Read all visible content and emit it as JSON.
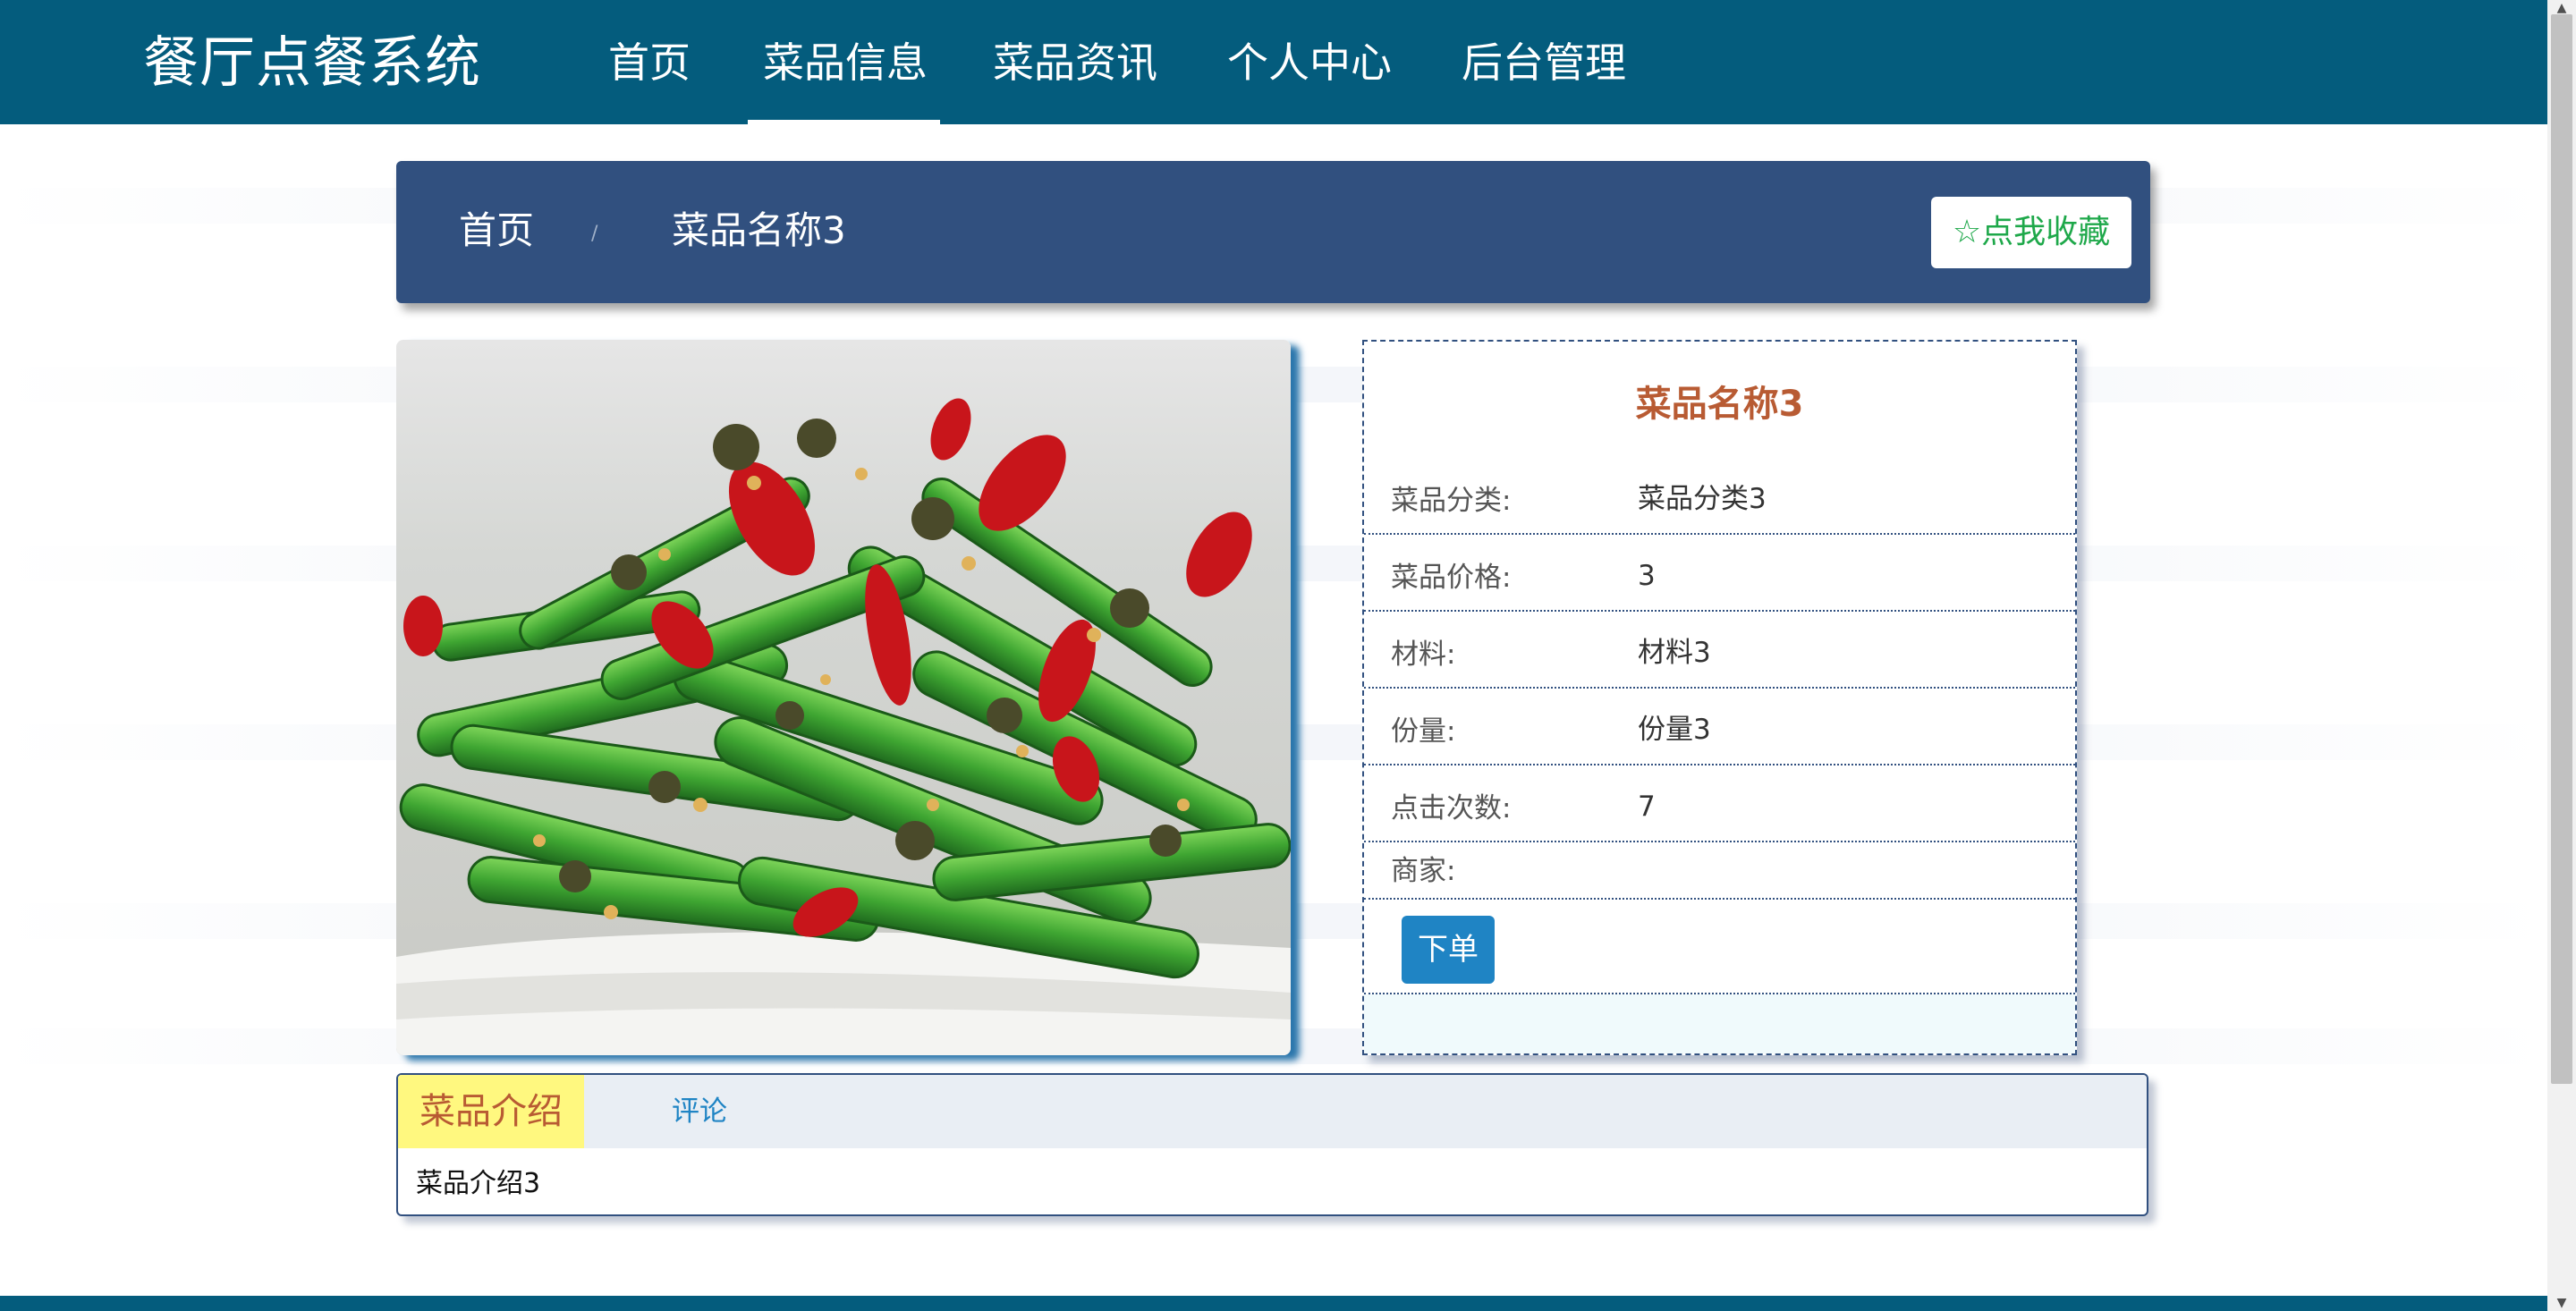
{
  "header": {
    "brand": "餐厅点餐系统",
    "nav": [
      "首页",
      "菜品信息",
      "菜品资讯",
      "个人中心",
      "后台管理"
    ],
    "active_index": 1
  },
  "breadcrumb": {
    "home": "首页",
    "separator": "/",
    "current": "菜品名称3"
  },
  "favorite_button": {
    "icon": "star-outline-icon",
    "label": "点我收藏"
  },
  "dish": {
    "image_alt": "dish-photo",
    "title": "菜品名称3",
    "fields": [
      {
        "label": "菜品分类:",
        "value": "菜品分类3"
      },
      {
        "label": "菜品价格:",
        "value": "3"
      },
      {
        "label": "材料:",
        "value": "材料3"
      },
      {
        "label": "份量:",
        "value": "份量3"
      },
      {
        "label": "点击次数:",
        "value": "7"
      },
      {
        "label": "商家:",
        "value": ""
      }
    ],
    "order_label": "下单"
  },
  "tabs": {
    "items": [
      "菜品介绍",
      "评论"
    ],
    "active_index": 0,
    "content": "菜品介绍3"
  },
  "colors": {
    "header_bg": "#045C7D",
    "breadcrumb_bg": "#31507F",
    "title_color": "#B85B33",
    "favorite_text": "#1EA84A",
    "button_blue": "#1F84C4",
    "active_tab_bg": "#FFF87F"
  }
}
